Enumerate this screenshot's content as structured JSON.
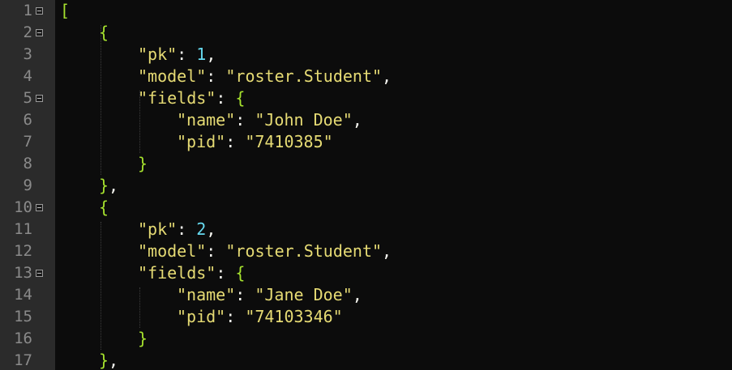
{
  "gutter": {
    "line_numbers": [
      "1",
      "2",
      "3",
      "4",
      "5",
      "6",
      "7",
      "8",
      "9",
      "10",
      "11",
      "12",
      "13",
      "14",
      "15",
      "16",
      "17"
    ],
    "fold_lines": [
      1,
      2,
      5,
      10,
      13
    ]
  },
  "code": {
    "lines": [
      {
        "indent": 0,
        "tokens": [
          {
            "t": "[",
            "c": "punc"
          }
        ]
      },
      {
        "indent": 1,
        "tokens": [
          {
            "t": "{",
            "c": "punc"
          }
        ]
      },
      {
        "indent": 2,
        "tokens": [
          {
            "t": "\"pk\"",
            "c": "key"
          },
          {
            "t": ": ",
            "c": "plain"
          },
          {
            "t": "1",
            "c": "num"
          },
          {
            "t": ",",
            "c": "plain"
          }
        ]
      },
      {
        "indent": 2,
        "tokens": [
          {
            "t": "\"model\"",
            "c": "key"
          },
          {
            "t": ": ",
            "c": "plain"
          },
          {
            "t": "\"roster.Student\"",
            "c": "str"
          },
          {
            "t": ",",
            "c": "plain"
          }
        ]
      },
      {
        "indent": 2,
        "tokens": [
          {
            "t": "\"fields\"",
            "c": "key"
          },
          {
            "t": ": ",
            "c": "plain"
          },
          {
            "t": "{",
            "c": "punc"
          }
        ]
      },
      {
        "indent": 3,
        "tokens": [
          {
            "t": "\"name\"",
            "c": "key"
          },
          {
            "t": ": ",
            "c": "plain"
          },
          {
            "t": "\"John Doe\"",
            "c": "str"
          },
          {
            "t": ",",
            "c": "plain"
          }
        ]
      },
      {
        "indent": 3,
        "tokens": [
          {
            "t": "\"pid\"",
            "c": "key"
          },
          {
            "t": ": ",
            "c": "plain"
          },
          {
            "t": "\"7410385\"",
            "c": "str"
          }
        ]
      },
      {
        "indent": 2,
        "tokens": [
          {
            "t": "}",
            "c": "punc"
          }
        ]
      },
      {
        "indent": 1,
        "tokens": [
          {
            "t": "}",
            "c": "punc"
          },
          {
            "t": ",",
            "c": "plain"
          }
        ]
      },
      {
        "indent": 1,
        "tokens": [
          {
            "t": "{",
            "c": "punc"
          }
        ]
      },
      {
        "indent": 2,
        "tokens": [
          {
            "t": "\"pk\"",
            "c": "key"
          },
          {
            "t": ": ",
            "c": "plain"
          },
          {
            "t": "2",
            "c": "num"
          },
          {
            "t": ",",
            "c": "plain"
          }
        ]
      },
      {
        "indent": 2,
        "tokens": [
          {
            "t": "\"model\"",
            "c": "key"
          },
          {
            "t": ": ",
            "c": "plain"
          },
          {
            "t": "\"roster.Student\"",
            "c": "str"
          },
          {
            "t": ",",
            "c": "plain"
          }
        ]
      },
      {
        "indent": 2,
        "tokens": [
          {
            "t": "\"fields\"",
            "c": "key"
          },
          {
            "t": ": ",
            "c": "plain"
          },
          {
            "t": "{",
            "c": "punc"
          }
        ]
      },
      {
        "indent": 3,
        "tokens": [
          {
            "t": "\"name\"",
            "c": "key"
          },
          {
            "t": ": ",
            "c": "plain"
          },
          {
            "t": "\"Jane Doe\"",
            "c": "str"
          },
          {
            "t": ",",
            "c": "plain"
          }
        ]
      },
      {
        "indent": 3,
        "tokens": [
          {
            "t": "\"pid\"",
            "c": "key"
          },
          {
            "t": ": ",
            "c": "plain"
          },
          {
            "t": "\"74103346\"",
            "c": "str"
          }
        ]
      },
      {
        "indent": 2,
        "tokens": [
          {
            "t": "}",
            "c": "punc"
          }
        ]
      },
      {
        "indent": 1,
        "tokens": [
          {
            "t": "}",
            "c": "punc"
          },
          {
            "t": ",",
            "c": "plain"
          }
        ]
      }
    ]
  },
  "colors": {
    "background": "#0c0c0c",
    "gutter_background": "#2b2b2b",
    "line_number": "#8a8a8a",
    "string": "#e6db74",
    "number": "#66d9ef",
    "bracket": "#a6e22e",
    "plain": "#f8f8f2"
  }
}
